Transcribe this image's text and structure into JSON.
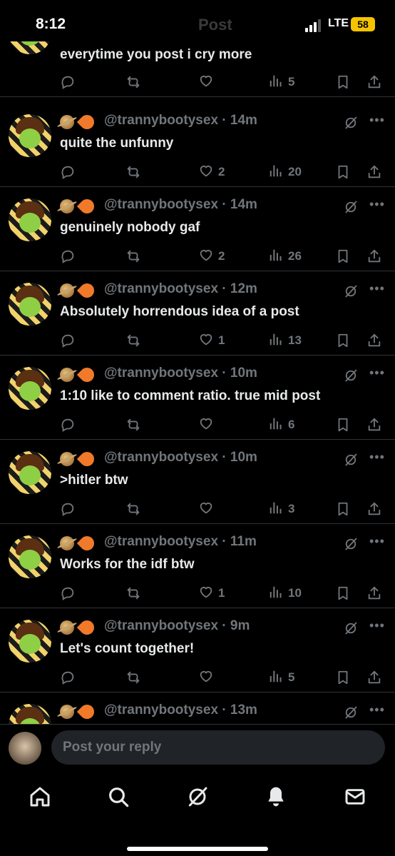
{
  "status_bar": {
    "time": "8:12",
    "network": "LTE",
    "battery": "58",
    "faded_title": "Post"
  },
  "colors": {
    "background": "#000000",
    "muted": "#71767b",
    "text": "#e7e9ea",
    "battery": "#f5c400"
  },
  "replies": [
    {
      "handle": "",
      "time": "",
      "text": "everytime you post i cry more",
      "likes": "",
      "views": "5"
    },
    {
      "handle": "@trannybootysex",
      "time": "14m",
      "text": "quite the unfunny",
      "likes": "2",
      "views": "20"
    },
    {
      "handle": "@trannybootysex",
      "time": "14m",
      "text": "genuinely nobody gaf",
      "likes": "2",
      "views": "26"
    },
    {
      "handle": "@trannybootysex",
      "time": "12m",
      "text": "Absolutely horrendous idea of a post",
      "likes": "1",
      "views": "13"
    },
    {
      "handle": "@trannybootysex",
      "time": "10m",
      "text": "1:10 like to comment ratio. true mid post",
      "likes": "",
      "views": "6"
    },
    {
      "handle": "@trannybootysex",
      "time": "10m",
      "text": ">hitler btw",
      "likes": "",
      "views": "3"
    },
    {
      "handle": "@trannybootysex",
      "time": "11m",
      "text": "Works for the idf btw",
      "likes": "1",
      "views": "10"
    },
    {
      "handle": "@trannybootysex",
      "time": "9m",
      "text": "Let's count together!",
      "likes": "",
      "views": "5"
    },
    {
      "handle": "@trannybootysex",
      "time": "13m",
      "text": "",
      "likes": "",
      "views": ""
    }
  ],
  "composer": {
    "placeholder": "Post your reply"
  },
  "icons": {
    "reply": "comment-icon",
    "repost": "repost-icon",
    "like": "heart-icon",
    "views": "views-icon",
    "bookmark": "bookmark-icon",
    "share": "share-icon",
    "grok": "grok-icon",
    "more": "more-icon"
  },
  "tabbar": [
    "home-icon",
    "search-icon",
    "grok-icon",
    "notifications-icon",
    "messages-icon"
  ]
}
